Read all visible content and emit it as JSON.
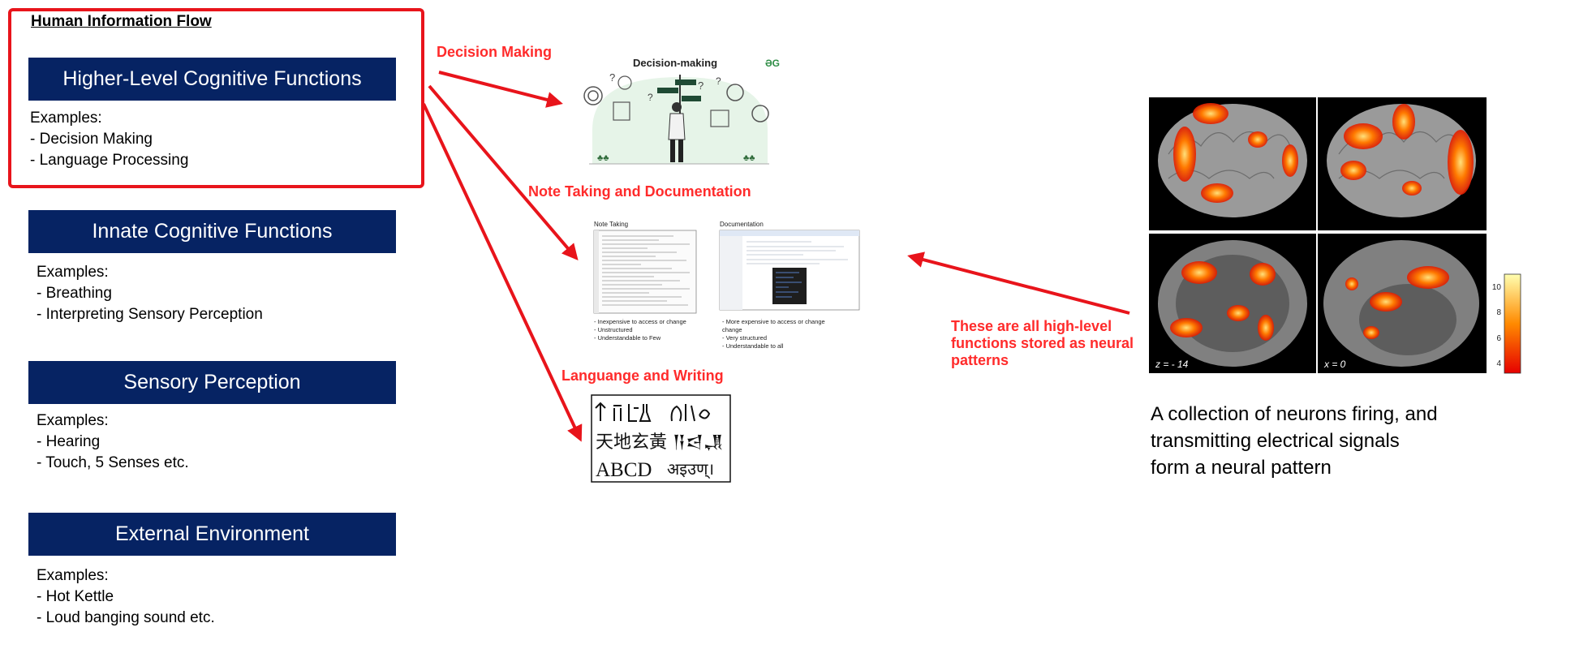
{
  "title": "Human Information Flow",
  "levels": [
    {
      "heading": "Higher-Level Cognitive Functions",
      "examples_label": "Examples:",
      "examples": [
        "- Decision Making",
        "- Language Processing"
      ]
    },
    {
      "heading": "Innate Cognitive Functions",
      "examples_label": "Examples:",
      "examples": [
        "- Breathing",
        "- Interpreting Sensory Perception"
      ]
    },
    {
      "heading": "Sensory Perception",
      "examples_label": "Examples:",
      "examples": [
        "- Hearing",
        "- Touch, 5 Senses etc."
      ]
    },
    {
      "heading": "External Environment",
      "examples_label": "Examples:",
      "examples": [
        "- Hot Kettle",
        "- Loud banging sound etc."
      ]
    }
  ],
  "callouts": {
    "decision": "Decision Making",
    "notes": "Note Taking and Documentation",
    "language": "Languange and Writing",
    "neural": "These are all high-level functions stored as neural patterns"
  },
  "decision_image": {
    "title": "Decision-making",
    "logo": "ƏG"
  },
  "notes_image": {
    "note_title": "Note Taking",
    "note_points": [
      "- Inexpensive to access or change",
      "- Unstructured",
      "- Understandable to Few"
    ],
    "doc_title": "Documentation",
    "doc_points": [
      "- More expensive to access or change",
      "- Very structured",
      "- Understandable to all"
    ]
  },
  "writing_image": {
    "row1": "𓀀𓉐𓏏𓆑𓂝𓊪",
    "row2": "天地玄黃 𒀀𒁀𒂗",
    "row3_latin": "ABCD",
    "row3_devanagari": "अइउण्।"
  },
  "brain_image": {
    "label_z": "z = - 14",
    "label_x": "x = 0",
    "scale_ticks": [
      "10",
      "8",
      "6",
      "4"
    ]
  },
  "brain_caption": [
    "A collection of neurons firing, and",
    "transmitting electrical signals",
    "form a neural pattern"
  ],
  "colors": {
    "bar": "#062363",
    "accent_red": "#e8141b",
    "callout_text": "#ff2b2b"
  }
}
